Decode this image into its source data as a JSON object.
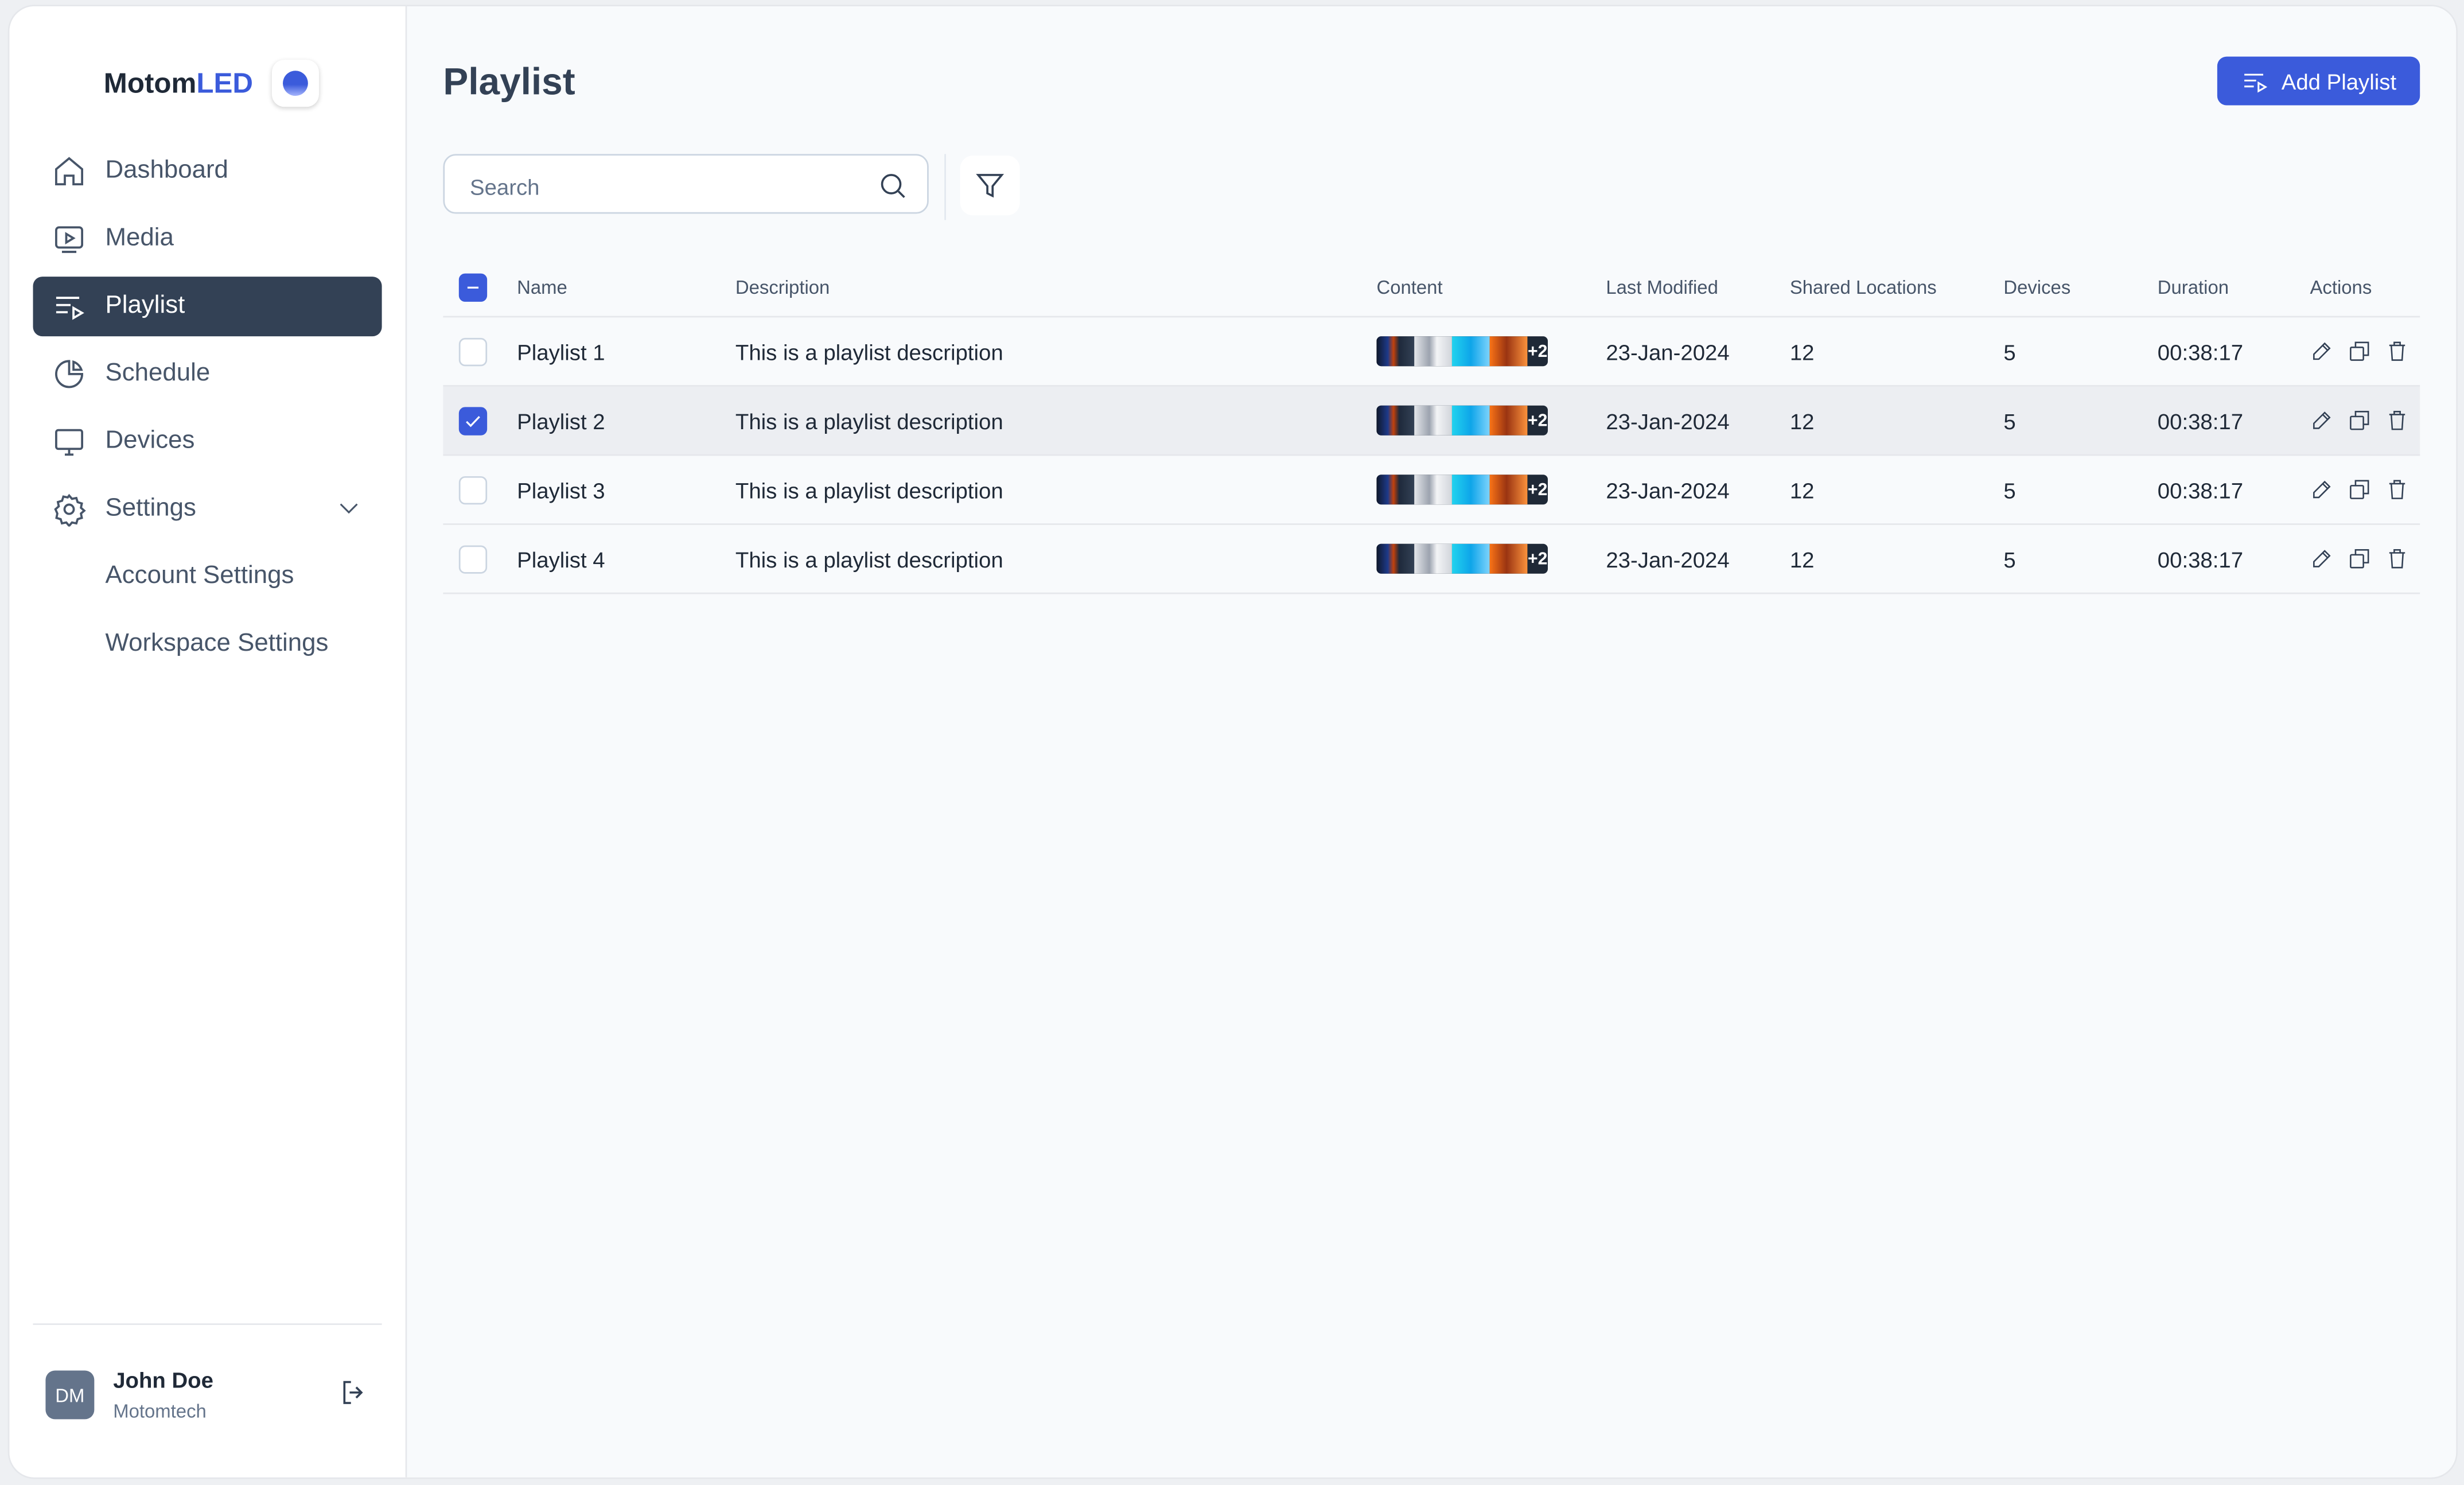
{
  "brand": {
    "name_part1": "Motom",
    "name_part2": "LED",
    "accent_color": "#3b5bdb"
  },
  "sidebar": {
    "items": [
      {
        "label": "Dashboard",
        "icon": "home-icon",
        "active": false
      },
      {
        "label": "Media",
        "icon": "media-play-icon",
        "active": false
      },
      {
        "label": "Playlist",
        "icon": "playlist-icon",
        "active": true
      },
      {
        "label": "Schedule",
        "icon": "clock-pie-icon",
        "active": false
      },
      {
        "label": "Devices",
        "icon": "monitor-icon",
        "active": false
      },
      {
        "label": "Settings",
        "icon": "gear-icon",
        "active": false,
        "expanded": true
      }
    ],
    "settings_subitems": [
      {
        "label": "Account Settings"
      },
      {
        "label": "Workspace Settings"
      }
    ]
  },
  "user": {
    "initials": "DM",
    "name": "John Doe",
    "org": "Motomtech"
  },
  "header": {
    "title": "Playlist",
    "add_button_label": "Add Playlist"
  },
  "search": {
    "placeholder": "Search",
    "value": ""
  },
  "table": {
    "columns": [
      "Name",
      "Description",
      "Content",
      "Last Modified",
      "Shared Locations",
      "Devices",
      "Duration",
      "Actions"
    ],
    "header_checkbox_state": "indeterminate",
    "rows": [
      {
        "name": "Playlist 1",
        "description": "This is a playlist description",
        "content_more": "+2",
        "last_modified": "23-Jan-2024",
        "shared_locations": "12",
        "devices": "5",
        "duration": "00:38:17",
        "selected": false
      },
      {
        "name": "Playlist 2",
        "description": "This is a playlist description",
        "content_more": "+2",
        "last_modified": "23-Jan-2024",
        "shared_locations": "12",
        "devices": "5",
        "duration": "00:38:17",
        "selected": true
      },
      {
        "name": "Playlist 3",
        "description": "This is a playlist description",
        "content_more": "+2",
        "last_modified": "23-Jan-2024",
        "shared_locations": "12",
        "devices": "5",
        "duration": "00:38:17",
        "selected": false
      },
      {
        "name": "Playlist 4",
        "description": "This is a playlist description",
        "content_more": "+2",
        "last_modified": "23-Jan-2024",
        "shared_locations": "12",
        "devices": "5",
        "duration": "00:38:17",
        "selected": false
      }
    ],
    "row_actions": [
      "edit-icon",
      "duplicate-icon",
      "delete-icon"
    ]
  }
}
